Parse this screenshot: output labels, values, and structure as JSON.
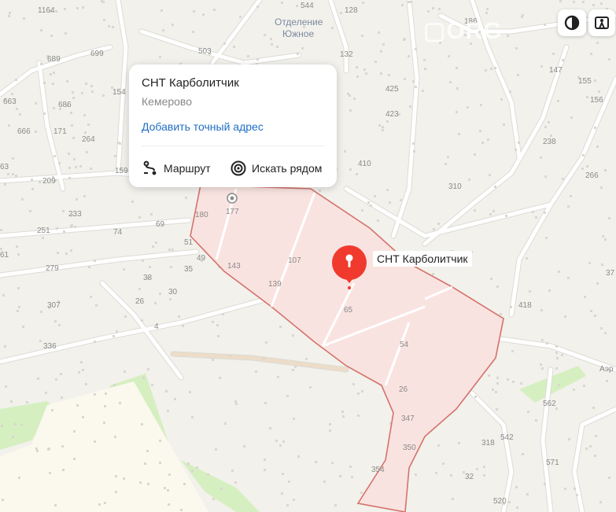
{
  "map": {
    "place_labels": [
      "Отделение Южное"
    ],
    "numbers": [
      "1164",
      "544",
      "128",
      "186",
      "689",
      "699",
      "503",
      "132",
      "147",
      "155",
      "663",
      "154",
      "686",
      "425",
      "156",
      "666",
      "171",
      "264",
      "423",
      "238",
      "63",
      "159",
      "209",
      "410",
      "266",
      "310",
      "233",
      "177",
      "180",
      "251",
      "74",
      "69",
      "51",
      "61",
      "107",
      "279",
      "49",
      "143",
      "35",
      "38",
      "139",
      "37",
      "30",
      "418",
      "26",
      "307",
      "65",
      "4",
      "336",
      "54",
      "Аэр",
      "26",
      "562",
      "347",
      "542",
      "350",
      "318",
      "354",
      "571",
      "32",
      "520"
    ],
    "building_label": "Отделение Южное"
  },
  "popup": {
    "title": "СНТ Карболитчик",
    "city": "Кемерово",
    "add_address_link": "Добавить точный адрес",
    "route_button": "Маршрут",
    "search_nearby_button": "Искать рядом"
  },
  "pin": {
    "label": "СНТ Карболитчик",
    "color": "#f03a2e"
  },
  "colors": {
    "area_fill": "#f9e3e0",
    "area_border": "#d4726b",
    "background": "#f2f1ec",
    "green": "#d6efc0"
  }
}
